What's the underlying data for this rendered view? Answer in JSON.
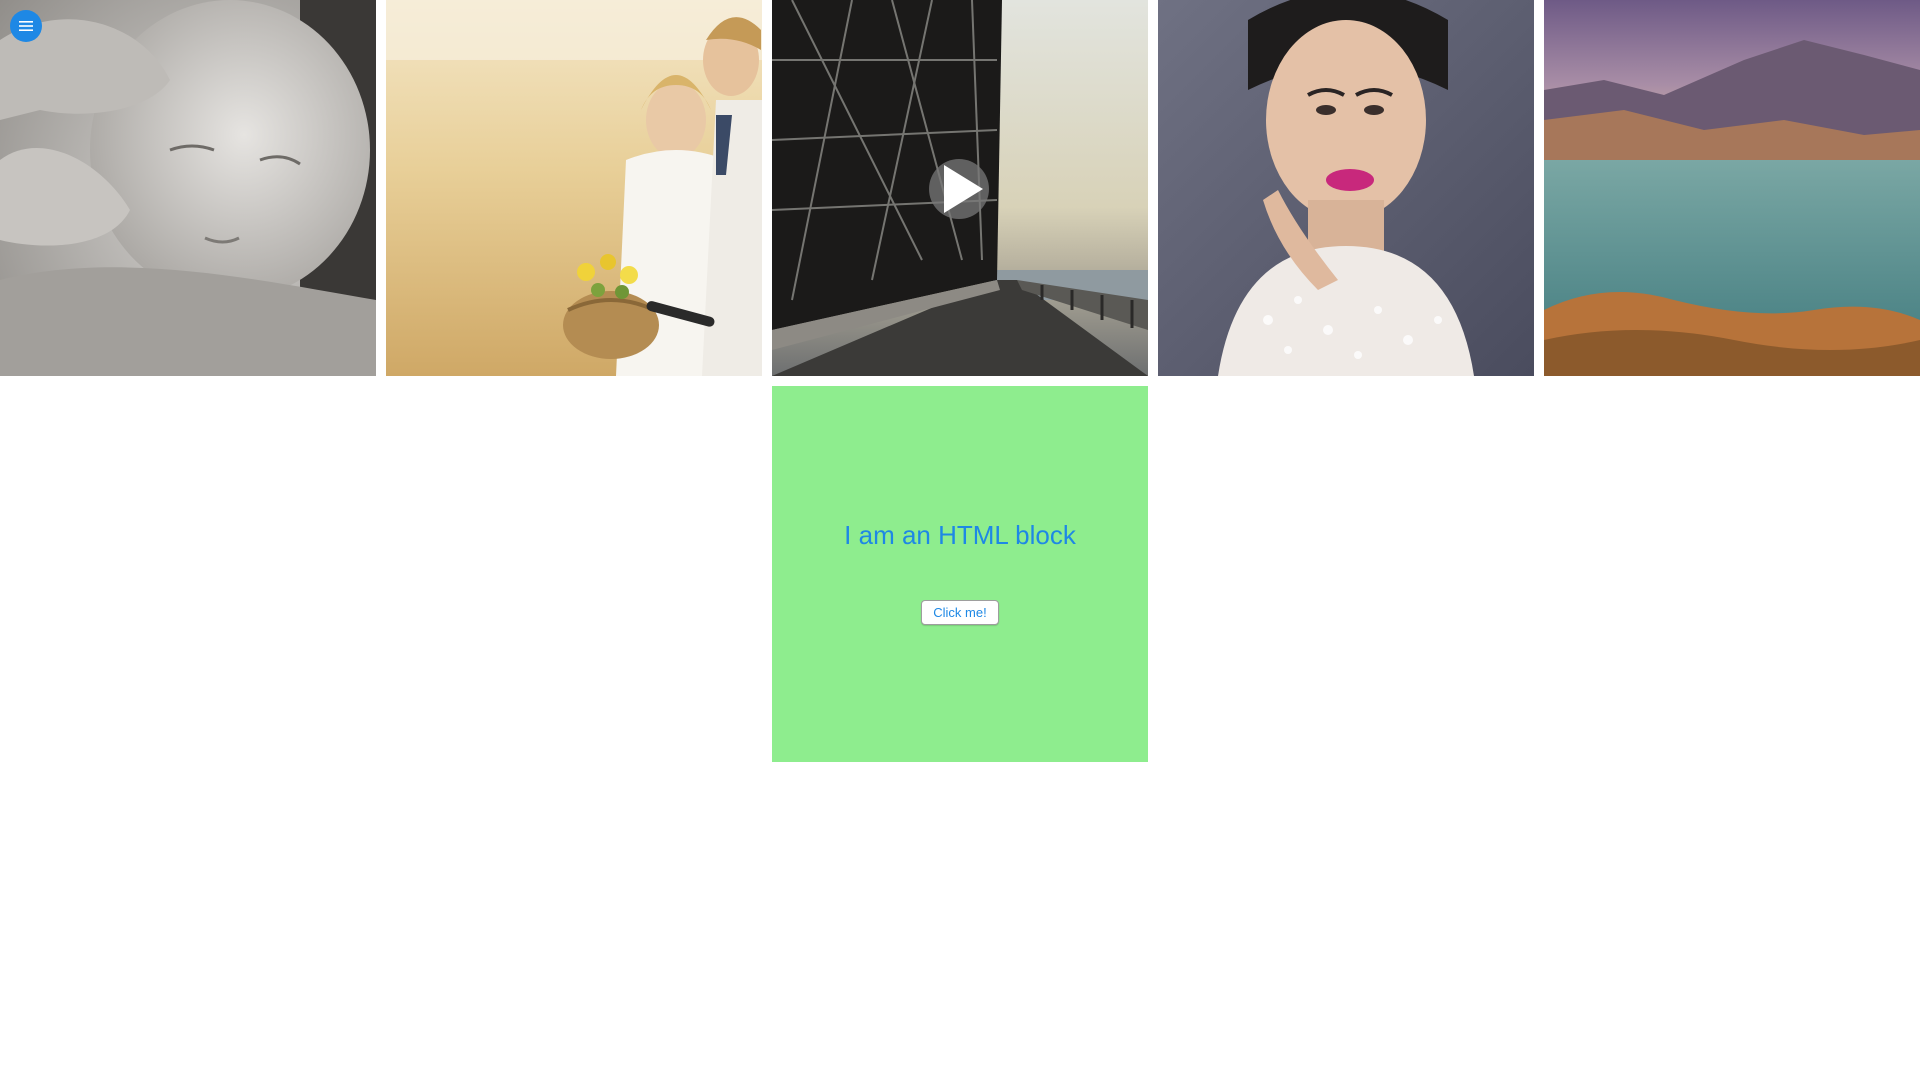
{
  "menu": {
    "icon": "hamburger-menu-icon",
    "color": "#1e88e5"
  },
  "gallery": {
    "items": [
      {
        "subject": "sleeping baby in hands (black and white)"
      },
      {
        "subject": "bride and groom in golden field with bicycle basket"
      },
      {
        "subject": "steel truss bridge walkway",
        "has_video": true,
        "play_icon": "play-icon"
      },
      {
        "subject": "portrait of woman in white embellished top"
      },
      {
        "subject": "lake with mountains at dusk"
      }
    ]
  },
  "html_block": {
    "heading": "I am an HTML block",
    "button_label": "Click me!",
    "background": "#8eed8e",
    "text_color": "#1e88e5"
  }
}
